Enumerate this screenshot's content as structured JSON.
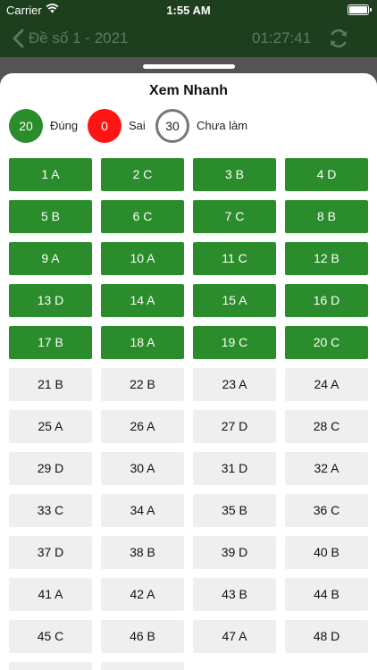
{
  "status_bar": {
    "carrier": "Carrier",
    "time": "1:55 AM",
    "wifi_icon": "wifi-icon",
    "battery_icon": "battery-icon"
  },
  "nav": {
    "title": "Đề số 1 - 2021",
    "timer": "01:27:41",
    "back_icon": "chevron-left-icon",
    "refresh_icon": "refresh-icon"
  },
  "sheet": {
    "title": "Xem Nhanh",
    "summary": {
      "correct_count": "20",
      "correct_label": "Đúng",
      "wrong_count": "0",
      "wrong_label": "Sai",
      "unanswered_count": "30",
      "unanswered_label": "Chưa làm"
    }
  },
  "colors": {
    "answered": "#2a8c2a",
    "unanswered": "#efefef",
    "wrong": "#ff1414",
    "nav_bar": "#1e3f1e"
  },
  "questions": [
    {
      "label": "1 A",
      "answered": true
    },
    {
      "label": "2 C",
      "answered": true
    },
    {
      "label": "3 B",
      "answered": true
    },
    {
      "label": "4 D",
      "answered": true
    },
    {
      "label": "5 B",
      "answered": true
    },
    {
      "label": "6 C",
      "answered": true
    },
    {
      "label": "7 C",
      "answered": true
    },
    {
      "label": "8 B",
      "answered": true
    },
    {
      "label": "9 A",
      "answered": true
    },
    {
      "label": "10 A",
      "answered": true
    },
    {
      "label": "11 C",
      "answered": true
    },
    {
      "label": "12 B",
      "answered": true
    },
    {
      "label": "13 D",
      "answered": true
    },
    {
      "label": "14 A",
      "answered": true
    },
    {
      "label": "15 A",
      "answered": true
    },
    {
      "label": "16 D",
      "answered": true
    },
    {
      "label": "17 B",
      "answered": true
    },
    {
      "label": "18 A",
      "answered": true
    },
    {
      "label": "19 C",
      "answered": true
    },
    {
      "label": "20 C",
      "answered": true
    },
    {
      "label": "21 B",
      "answered": false
    },
    {
      "label": "22 B",
      "answered": false
    },
    {
      "label": "23 A",
      "answered": false
    },
    {
      "label": "24 A",
      "answered": false
    },
    {
      "label": "25 A",
      "answered": false
    },
    {
      "label": "26 A",
      "answered": false
    },
    {
      "label": "27 D",
      "answered": false
    },
    {
      "label": "28 C",
      "answered": false
    },
    {
      "label": "29 D",
      "answered": false
    },
    {
      "label": "30 A",
      "answered": false
    },
    {
      "label": "31 D",
      "answered": false
    },
    {
      "label": "32 A",
      "answered": false
    },
    {
      "label": "33 C",
      "answered": false
    },
    {
      "label": "34 A",
      "answered": false
    },
    {
      "label": "35 B",
      "answered": false
    },
    {
      "label": "36 C",
      "answered": false
    },
    {
      "label": "37 D",
      "answered": false
    },
    {
      "label": "38 B",
      "answered": false
    },
    {
      "label": "39 D",
      "answered": false
    },
    {
      "label": "40 B",
      "answered": false
    },
    {
      "label": "41 A",
      "answered": false
    },
    {
      "label": "42 A",
      "answered": false
    },
    {
      "label": "43 B",
      "answered": false
    },
    {
      "label": "44 B",
      "answered": false
    },
    {
      "label": "45 C",
      "answered": false
    },
    {
      "label": "46 B",
      "answered": false
    },
    {
      "label": "47 A",
      "answered": false
    },
    {
      "label": "48 D",
      "answered": false
    },
    {
      "label": "",
      "answered": false
    },
    {
      "label": "",
      "answered": false
    }
  ]
}
